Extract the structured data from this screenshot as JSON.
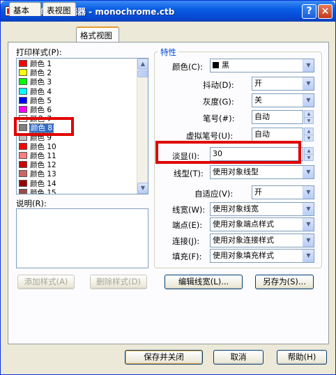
{
  "window": {
    "title": "打印样式表编辑器 - monochrome.ctb",
    "help_btn": "?",
    "close_btn": "×"
  },
  "tabs": [
    "基本",
    "表视图",
    "格式视图"
  ],
  "left": {
    "styles_label": "打印样式(P):",
    "desc_label": "说明(R):",
    "add_btn": "添加样式(A)",
    "delete_btn": "删除样式(D)",
    "styles": [
      {
        "name": "颜色 1",
        "color": "#ff0000"
      },
      {
        "name": "颜色 2",
        "color": "#ffff00"
      },
      {
        "name": "颜色 3",
        "color": "#00ff00"
      },
      {
        "name": "颜色 4",
        "color": "#00ffff"
      },
      {
        "name": "颜色 5",
        "color": "#0000ff"
      },
      {
        "name": "颜色 6",
        "color": "#ff00ff"
      },
      {
        "name": "颜色 7",
        "color": "#ffffff"
      },
      {
        "name": "颜色 8",
        "color": "#808080",
        "selected": true
      },
      {
        "name": "颜色 9",
        "color": "#c0c0c0"
      },
      {
        "name": "颜色 10",
        "color": "#ff0000"
      },
      {
        "name": "颜色 11",
        "color": "#ff7f7f"
      },
      {
        "name": "颜色 12",
        "color": "#cc0000"
      },
      {
        "name": "颜色 13",
        "color": "#cc6666"
      },
      {
        "name": "颜色 14",
        "color": "#990000"
      },
      {
        "name": "颜色 15",
        "color": "#994c4c"
      }
    ]
  },
  "props": {
    "group_title": "特性",
    "color": {
      "label": "颜色(C):",
      "value": "黑"
    },
    "dither": {
      "label": "抖动(D):",
      "value": "开"
    },
    "grayscale": {
      "label": "灰度(G):",
      "value": "关"
    },
    "pen": {
      "label": "笔号(#):",
      "value": "自动"
    },
    "virtual_pen": {
      "label": "虚拟笔号(U):",
      "value": "自动"
    },
    "screening": {
      "label": "淡显(I):",
      "value": "30"
    },
    "linetype": {
      "label": "线型(T):",
      "value": "使用对象线型"
    },
    "adaptive": {
      "label": "自适应(V):",
      "value": "开"
    },
    "lineweight": {
      "label": "线宽(W):",
      "value": "使用对象线宽"
    },
    "endstyle": {
      "label": "端点(E):",
      "value": "使用对象端点样式"
    },
    "joinstyle": {
      "label": "连接(J):",
      "value": "使用对象连接样式"
    },
    "fillstyle": {
      "label": "填充(F):",
      "value": "使用对象填充样式"
    },
    "edit_lw_btn": "编辑线宽(L)...",
    "saveas_btn": "另存为(S)..."
  },
  "footer": {
    "save_close": "保存并关闭",
    "cancel": "取消",
    "help": "帮助(H)"
  }
}
